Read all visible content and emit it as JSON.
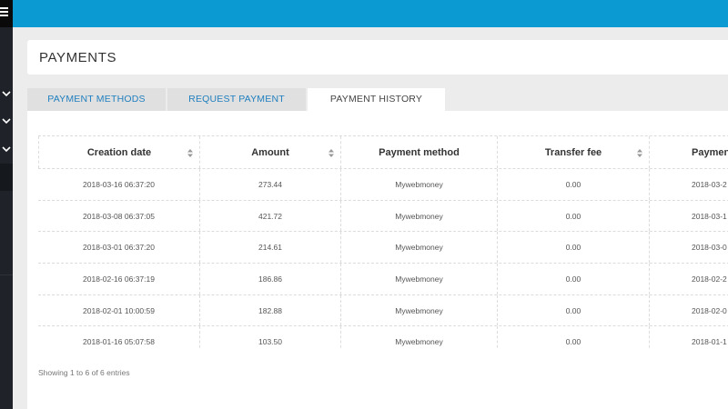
{
  "header": {
    "title": "PAYMENTS"
  },
  "tabs": [
    {
      "label": "PAYMENT METHODS",
      "active": false
    },
    {
      "label": "REQUEST PAYMENT",
      "active": false
    },
    {
      "label": "PAYMENT HISTORY",
      "active": true
    }
  ],
  "table": {
    "columns": [
      "Creation date",
      "Amount",
      "Payment method",
      "Transfer fee",
      "Payment"
    ],
    "rows": [
      [
        "2018-03-16 06:37:20",
        "273.44",
        "Mywebmoney",
        "0.00",
        "2018-03-2"
      ],
      [
        "2018-03-08 06:37:05",
        "421.72",
        "Mywebmoney",
        "0.00",
        "2018-03-1"
      ],
      [
        "2018-03-01 06:37:20",
        "214.61",
        "Mywebmoney",
        "0.00",
        "2018-03-0"
      ],
      [
        "2018-02-16 06:37:19",
        "186.86",
        "Mywebmoney",
        "0.00",
        "2018-02-2"
      ],
      [
        "2018-02-01 10:00:59",
        "182.88",
        "Mywebmoney",
        "0.00",
        "2018-02-0"
      ],
      [
        "2018-01-16 05:07:58",
        "103.50",
        "Mywebmoney",
        "0.00",
        "2018-01-1"
      ]
    ],
    "info": "Showing 1 to 6 of 6 entries"
  },
  "colors": {
    "topbar": "#0b9ad1",
    "sidebar": "#1f2329",
    "link": "#1f7fbf"
  },
  "icons": {
    "menu": "hamburger-icon",
    "expand": "chevron-down-icon",
    "sort": "sort-icon"
  }
}
